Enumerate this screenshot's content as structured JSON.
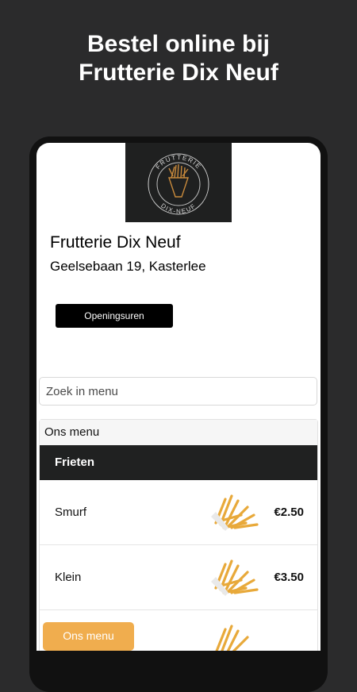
{
  "headline": {
    "line1": "Bestel online bij",
    "line2": "Frutterie Dix Neuf"
  },
  "logo": {
    "top_text": "FRUTTERIE",
    "bottom_text": "DIX-NEUF"
  },
  "shop": {
    "name": "Frutterie Dix Neuf",
    "address": "Geelsebaan 19, Kasterlee",
    "hours_button": "Openingsuren"
  },
  "search": {
    "placeholder": "Zoek in menu"
  },
  "menu": {
    "title": "Ons menu",
    "category": "Frieten",
    "items": [
      {
        "name": "Smurf",
        "price": "€2.50"
      },
      {
        "name": "Klein",
        "price": "€3.50"
      },
      {
        "name": "",
        "price": ""
      }
    ]
  },
  "floating_button": {
    "label": "Ons menu"
  },
  "colors": {
    "background": "#2b2b2c",
    "accent": "#f0ad4e",
    "category_bar": "#202121"
  }
}
